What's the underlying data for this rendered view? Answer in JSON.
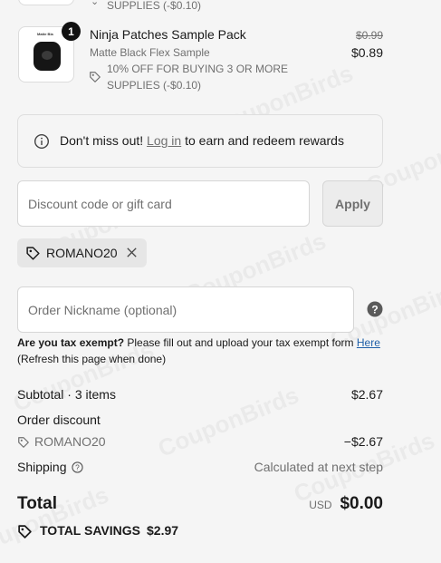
{
  "prev_item": {
    "promo_text_tail": "SUPPLIES (-$0.10)"
  },
  "item": {
    "quantity": "1",
    "thumb_caption": "Matte Bla",
    "name": "Ninja Patches Sample Pack",
    "variant": "Matte Black Flex Sample",
    "promo_line1": "10% OFF FOR BUYING 3 OR MORE",
    "promo_line2": "SUPPLIES (-$0.10)",
    "original_price": "$0.99",
    "price": "$0.89"
  },
  "rewards": {
    "prefix": "Don't miss out!",
    "link": "Log in",
    "suffix": "to earn and redeem rewards"
  },
  "discount": {
    "placeholder": "Discount code or gift card",
    "apply_label": "Apply",
    "applied_code": "ROMANO20"
  },
  "nickname": {
    "placeholder": "Order Nickname (optional)"
  },
  "tax": {
    "question": "Are you tax exempt?",
    "text": "Please fill out and upload your tax exempt form",
    "link": "Here",
    "note": "(Refresh this page when done)"
  },
  "summary": {
    "subtotal_label": "Subtotal · 3 items",
    "subtotal_value": "$2.67",
    "order_discount_label": "Order discount",
    "discount_code": "ROMANO20",
    "discount_value": "−$2.67",
    "shipping_label": "Shipping",
    "shipping_value": "Calculated at next step",
    "total_label": "Total",
    "currency": "USD",
    "total_value": "$0.00",
    "savings_label": "TOTAL SAVINGS",
    "savings_value": "$2.97"
  },
  "watermark_text": "CouponBirds"
}
